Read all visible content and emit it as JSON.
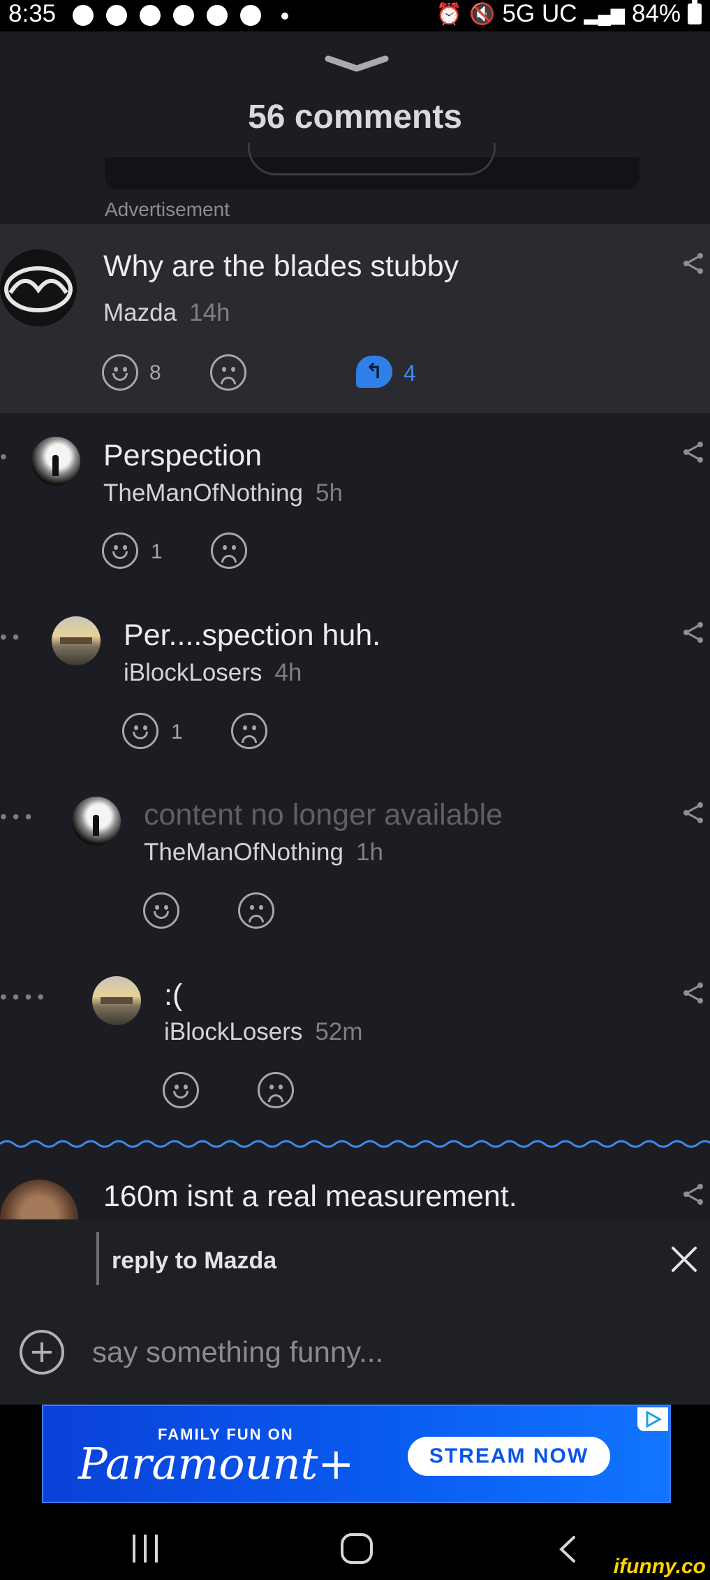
{
  "status_bar": {
    "time": "8:35",
    "network": "5G UC",
    "battery": "84%"
  },
  "header": {
    "title": "56 comments"
  },
  "ad_label": "Advertisement",
  "comments": [
    {
      "text": "Why are the blades stubby",
      "author": "Mazda",
      "age": "14h",
      "smile_count": "8",
      "frown_count": "",
      "reply_count": "4",
      "depth": 0
    },
    {
      "text": "Perspection",
      "author": "TheManOfNothing",
      "age": "5h",
      "smile_count": "1",
      "frown_count": "",
      "depth": 1
    },
    {
      "text": "Per....spection huh.",
      "author": "iBlockLosers",
      "age": "4h",
      "smile_count": "1",
      "frown_count": "",
      "depth": 2
    },
    {
      "text": "content no longer available",
      "author": "TheManOfNothing",
      "age": "1h",
      "smile_count": "",
      "frown_count": "",
      "depth": 3
    },
    {
      "text": ":(",
      "author": "iBlockLosers",
      "age": "52m",
      "smile_count": "",
      "frown_count": "",
      "depth": 4
    },
    {
      "text": "160m isnt a real measurement.",
      "author": "",
      "age": "",
      "depth": 0
    }
  ],
  "reply_box": {
    "reply_to": "reply to Mazda",
    "placeholder": "say something funny..."
  },
  "ad_banner": {
    "tagline": "FAMILY FUN ON",
    "brand": "Paramount+",
    "cta": "STREAM NOW"
  },
  "watermark": "ifunny.co",
  "colors": {
    "background": "#1c1d22",
    "highlight": "#2a2b30",
    "accent_blue": "#2f7fe8",
    "banner_blue": "#0a5ef2"
  },
  "icons": [
    "chevron-down-icon",
    "share-icon",
    "smile-icon",
    "frown-icon",
    "reply-icon",
    "close-icon",
    "plus-icon",
    "nav-recents-icon",
    "nav-home-icon",
    "nav-back-icon"
  ]
}
